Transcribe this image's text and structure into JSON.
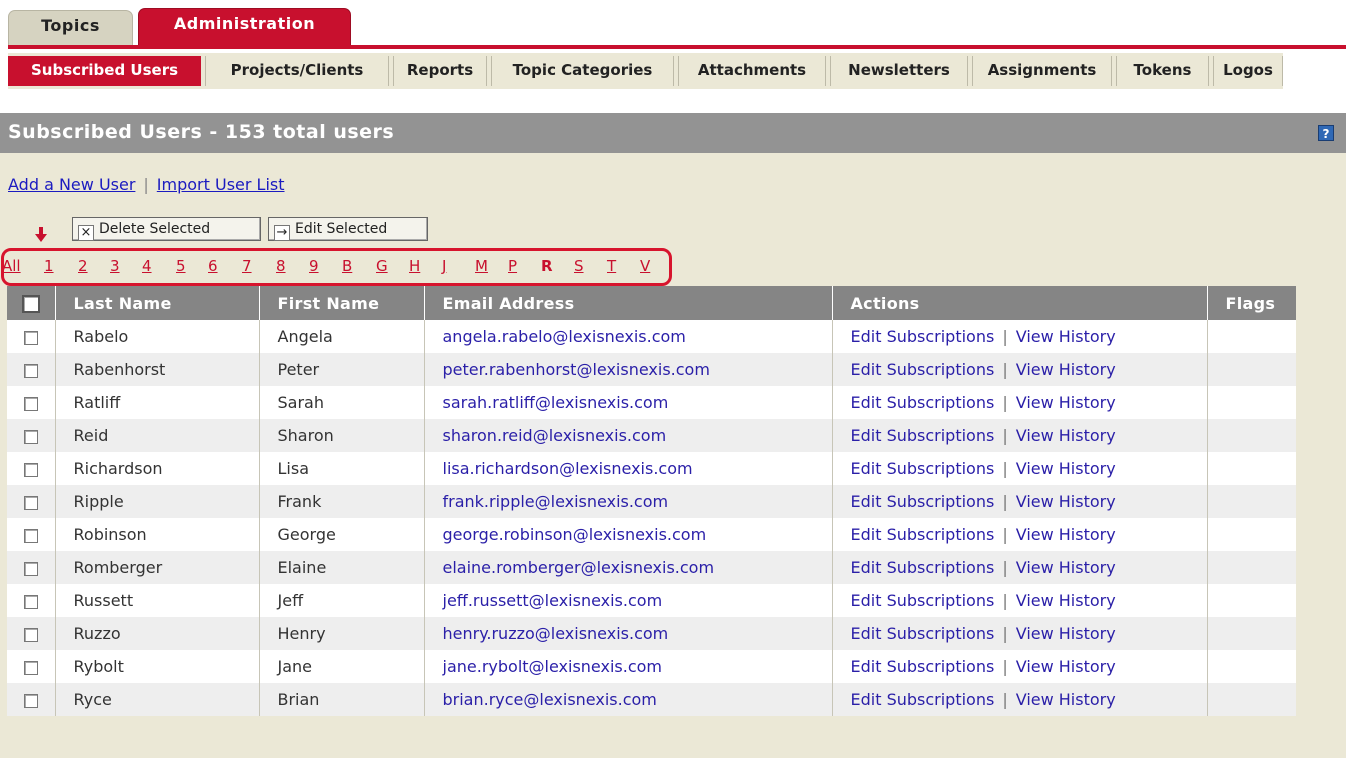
{
  "top_tabs": [
    {
      "label": "Topics"
    },
    {
      "label": "Administration"
    }
  ],
  "subnav": [
    {
      "label": "Subscribed Users",
      "active": true
    },
    {
      "label": "Projects/Clients"
    },
    {
      "label": "Reports"
    },
    {
      "label": "Topic Categories"
    },
    {
      "label": "Attachments"
    },
    {
      "label": "Newsletters"
    },
    {
      "label": "Assignments"
    },
    {
      "label": "Tokens"
    },
    {
      "label": "Logos"
    }
  ],
  "panel": {
    "title": "Subscribed Users - 153 total users",
    "help_icon": "?"
  },
  "links": {
    "add_user": "Add a New User",
    "separator": "|",
    "import_list": "Import User List"
  },
  "toolbar": {
    "delete_label": "Delete Selected",
    "delete_icon": "×",
    "edit_label": "Edit Selected",
    "edit_icon": "→"
  },
  "letters": [
    "All",
    "1",
    "2",
    "3",
    "4",
    "5",
    "6",
    "7",
    "8",
    "9",
    "B",
    "G",
    "H",
    "J",
    "M",
    "P",
    "R",
    "S",
    "T",
    "V"
  ],
  "current_letter": "R",
  "columns": [
    "",
    "Last Name",
    "First Name",
    "Email Address",
    "Actions",
    "Flags"
  ],
  "actions": {
    "edit": "Edit Subscriptions",
    "separator": "|",
    "history": "View History"
  },
  "users": [
    {
      "last": "Rabelo",
      "first": "Angela",
      "email": "angela.rabelo@lexisnexis.com"
    },
    {
      "last": "Rabenhorst",
      "first": "Peter",
      "email": "peter.rabenhorst@lexisnexis.com"
    },
    {
      "last": "Ratliff",
      "first": "Sarah",
      "email": "sarah.ratliff@lexisnexis.com"
    },
    {
      "last": "Reid",
      "first": "Sharon",
      "email": "sharon.reid@lexisnexis.com"
    },
    {
      "last": "Richardson",
      "first": "Lisa",
      "email": "lisa.richardson@lexisnexis.com"
    },
    {
      "last": "Ripple",
      "first": "Frank",
      "email": "frank.ripple@lexisnexis.com"
    },
    {
      "last": "Robinson",
      "first": "George",
      "email": "george.robinson@lexisnexis.com"
    },
    {
      "last": "Romberger",
      "first": "Elaine",
      "email": "elaine.romberger@lexisnexis.com"
    },
    {
      "last": "Russett",
      "first": "Jeff",
      "email": "jeff.russett@lexisnexis.com"
    },
    {
      "last": "Ruzzo",
      "first": "Henry",
      "email": "henry.ruzzo@lexisnexis.com"
    },
    {
      "last": "Rybolt",
      "first": "Jane",
      "email": "jane.rybolt@lexisnexis.com"
    },
    {
      "last": "Ryce",
      "first": "Brian",
      "email": "brian.ryce@lexisnexis.com"
    }
  ],
  "colors": {
    "accent": "#c8102e",
    "link": "#2a1fa8",
    "header": "#939393",
    "panel_bg": "#ebe8d6"
  }
}
